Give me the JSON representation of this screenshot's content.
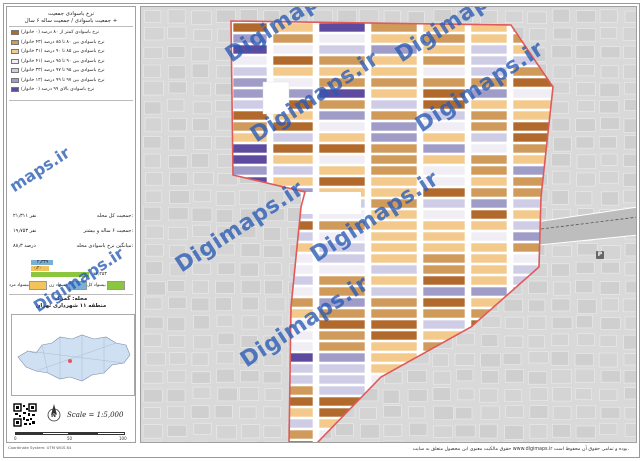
{
  "panel": {
    "title_line1": "نرخ باسوادی جمعیت",
    "title_line2": "جمعیت باسوادی / جمعیت ساله ۶ سال +",
    "legend": [
      {
        "label": "نرخ باسوادی کمتر از ۸۰ درصد (۰ خانوار)",
        "color": "#b26a2c"
      },
      {
        "label": "نرخ باسوادی بین ۸۰ تا ۸۵ درصد (۴۳ خانوار)",
        "color": "#cf9a5a"
      },
      {
        "label": "نرخ باسوادی بین ۸۵ تا ۹۰ درصد (۳۱ خانوار)",
        "color": "#f3c98c"
      },
      {
        "label": "نرخ باسوادی بین ۹۰ تا ۹۵ درصد (۴۱ خانوار)",
        "color": "#f0eef4"
      },
      {
        "label": "نرخ باسوادی بین ۹۵ تا ۹۷ درصد (۳۳ خانوار)",
        "color": "#cfcde6"
      },
      {
        "label": "نرخ باسوادی بین ۹۷ تا ۹۹ درصد (۱۳ خانوار)",
        "color": "#a09cc8"
      },
      {
        "label": "نرخ باسوادی بالای ۹۹ درصد (۰ خانوار)",
        "color": "#5e4a9e"
      }
    ],
    "stats": [
      {
        "label": "جمعیت کل محله:",
        "value": "۲۱٫۳۱۱ نفر"
      },
      {
        "label": "جمعیت ۶ ساله و بیشتر:",
        "value": "۱۹٫۷۵۳ نفر"
      },
      {
        "label": "میانگین نرخ باسوادی محله:",
        "value": "۸۸٫۳ درصد"
      }
    ],
    "bars": [
      {
        "label": "۲٫۳۳۹",
        "color": "#7ab0d6",
        "fraction": 0.22
      },
      {
        "label": "۰٫۲۰",
        "color": "#f2c45a",
        "fraction": 0.18
      },
      {
        "label": "۱۷٫۲۵۳",
        "color": "#8cc63e",
        "fraction": 0.58
      }
    ],
    "categories": [
      {
        "label": "بیسواد کل",
        "color": "#8cc63e"
      },
      {
        "label": "بیسواد زن",
        "color": "#7ab0d6"
      },
      {
        "label": "بیسواد مرد",
        "color": "#f2c45a"
      }
    ],
    "neighborhood_line1": "محله: گمرک",
    "neighborhood_line2": "منطقه ۱۱ شهرداری تهران",
    "scale_text": "Scale = 1:5,000",
    "north_letter": "N",
    "scale_ticks": [
      "0",
      "50",
      "100"
    ]
  },
  "watermarks": [
    {
      "text": "Digimaps.ir"
    },
    {
      "text": "Digimaps.ir"
    },
    {
      "text": "Digimaps.ir"
    },
    {
      "text": "Digimaps.ir"
    },
    {
      "text": "Digimaps.ir"
    },
    {
      "text": "Digimaps.ir"
    },
    {
      "text": "Digimaps.ir"
    }
  ],
  "side_watermarks": [
    {
      "text": "maps.ir"
    },
    {
      "text": "Digimaps.ir"
    }
  ],
  "pins": [
    {
      "letter": "P"
    }
  ],
  "footer": {
    "text": "حقوق مالکیت معنوی این محصول متعلق به سایت www.digimaps.ir بوده و تمامی حقوق آن محفوظ است.",
    "left_text": "Coordinate System: UTM WGS 84"
  },
  "colors": {
    "boundary": "#e05a5a",
    "road": "#ffffff",
    "outside": "#d9d9d9"
  }
}
